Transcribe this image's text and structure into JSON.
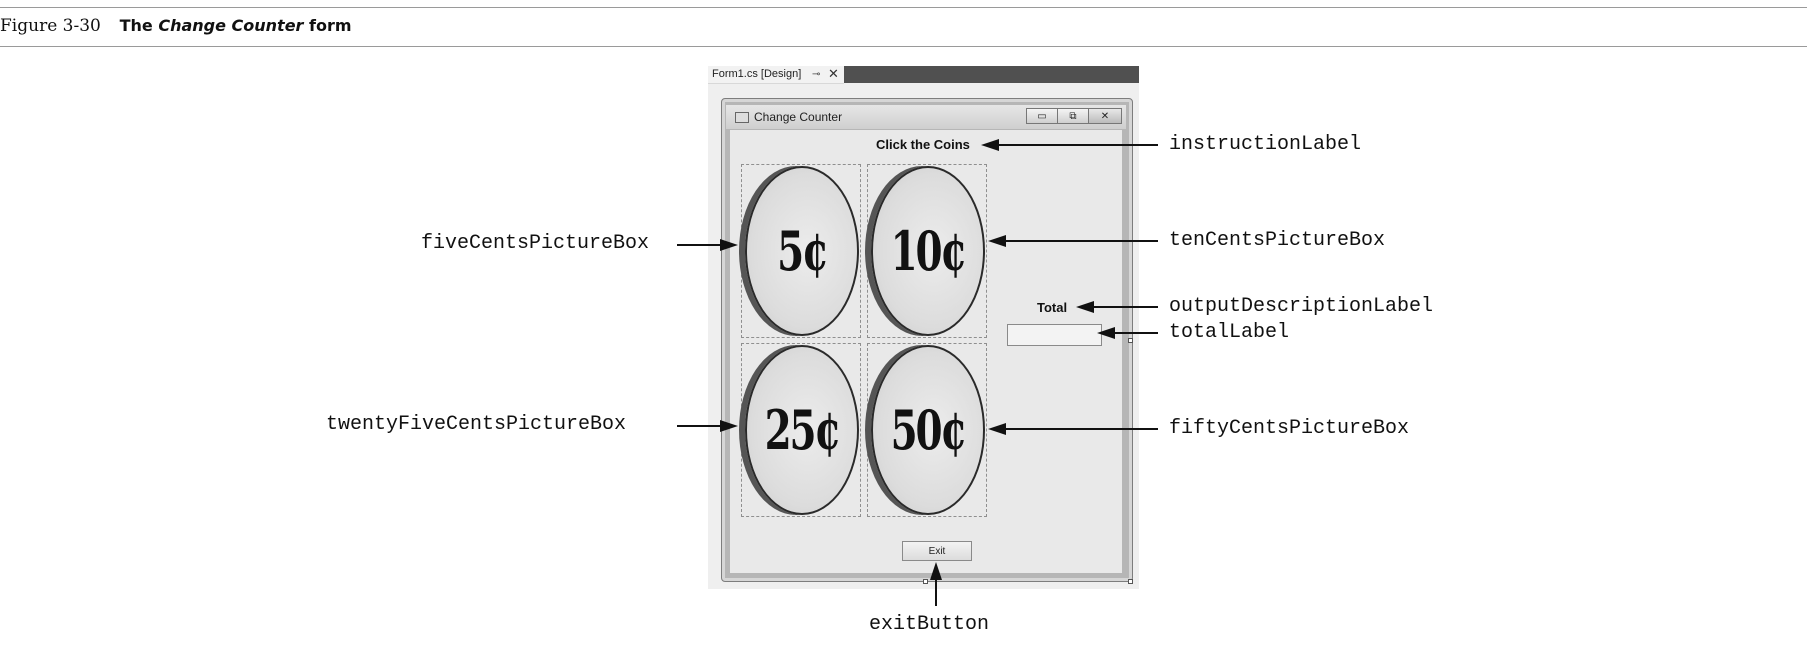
{
  "caption": {
    "figure_number": "Figure 3-30",
    "title_prefix": "The ",
    "title_italic": "Change Counter",
    "title_suffix": " form"
  },
  "designer": {
    "tab_label": "Form1.cs [Design]",
    "pin_glyph": "⊸",
    "close_glyph": "✕"
  },
  "form": {
    "title": "Change Counter",
    "min_glyph": "▭",
    "max_glyph": "⧉",
    "close_glyph": "✕",
    "instruction_text": "Click the Coins",
    "total_description": "Total",
    "total_value": "",
    "coins": [
      {
        "text": "5¢"
      },
      {
        "text": "10¢"
      },
      {
        "text": "25¢"
      },
      {
        "text": "50¢"
      }
    ],
    "exit_label": "Exit"
  },
  "callouts": {
    "instruction": "instructionLabel",
    "five": "fiveCentsPictureBox",
    "ten": "tenCentsPictureBox",
    "output_desc": "outputDescriptionLabel",
    "total": "totalLabel",
    "twenty_five": "twentyFiveCentsPictureBox",
    "fifty": "fiftyCentsPictureBox",
    "exit": "exitButton"
  }
}
